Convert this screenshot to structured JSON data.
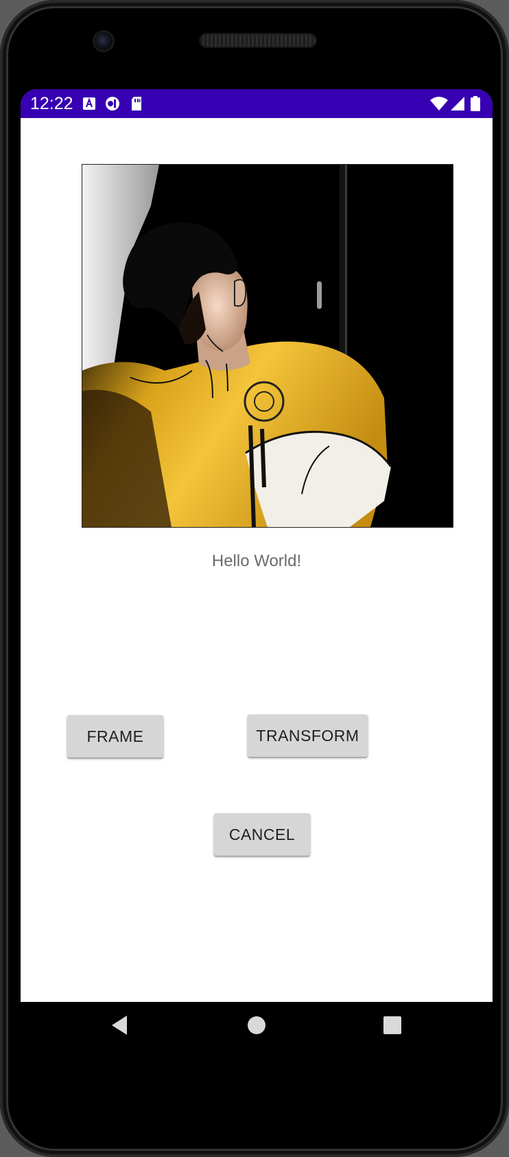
{
  "status_bar": {
    "time": "12:22",
    "background": "#3700b3",
    "left_icons": [
      "keyboard-a-icon",
      "tracking-icon",
      "sd-card-icon"
    ],
    "right_icons": [
      "wifi-icon",
      "cellular-signal-icon",
      "battery-icon"
    ]
  },
  "main": {
    "image_label": "cartoon-filtered-photo",
    "hello_text": "Hello World!",
    "buttons": {
      "frame_label": "FRAME",
      "transform_label": "TRANSFORM",
      "cancel_label": "CANCEL"
    }
  },
  "navigation": {
    "icons": [
      "back-icon",
      "home-icon",
      "recents-icon"
    ]
  }
}
